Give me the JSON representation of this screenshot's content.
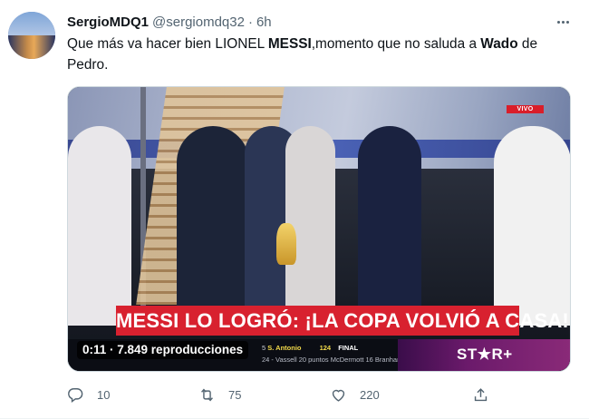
{
  "author": {
    "display_name": "SergioMDQ1",
    "handle": "@sergiomdq32",
    "separator": "·",
    "time": "6h",
    "avatar_icon": "avatar-image"
  },
  "tweet": {
    "text_part1": "Que más va hacer bien LIONEL ",
    "text_bold1": "MESSI",
    "text_part2": ",momento que no saluda a ",
    "text_bold2": "Wado",
    "text_part3": " de Pedro."
  },
  "media": {
    "live_badge": "VIVO",
    "headline": "MESSI LO LOGRÓ: ¡LA COPA VOLVIÓ A CASA!",
    "views_label": "0:11 · 7.849 reproducciones",
    "ticker_team": "S. Antonio",
    "ticker_prefix": "5",
    "ticker_score": "124",
    "ticker_final": "FINAL",
    "ticker_line2": "24 - Vassell 20 puntos   McDermott 16   Branham 14",
    "brand": "ST★R+"
  },
  "actions": {
    "reply_count": "10",
    "retweet_count": "75",
    "like_count": "220"
  },
  "colors": {
    "secondary_text": "#536471",
    "banner_red": "#d8212f"
  }
}
